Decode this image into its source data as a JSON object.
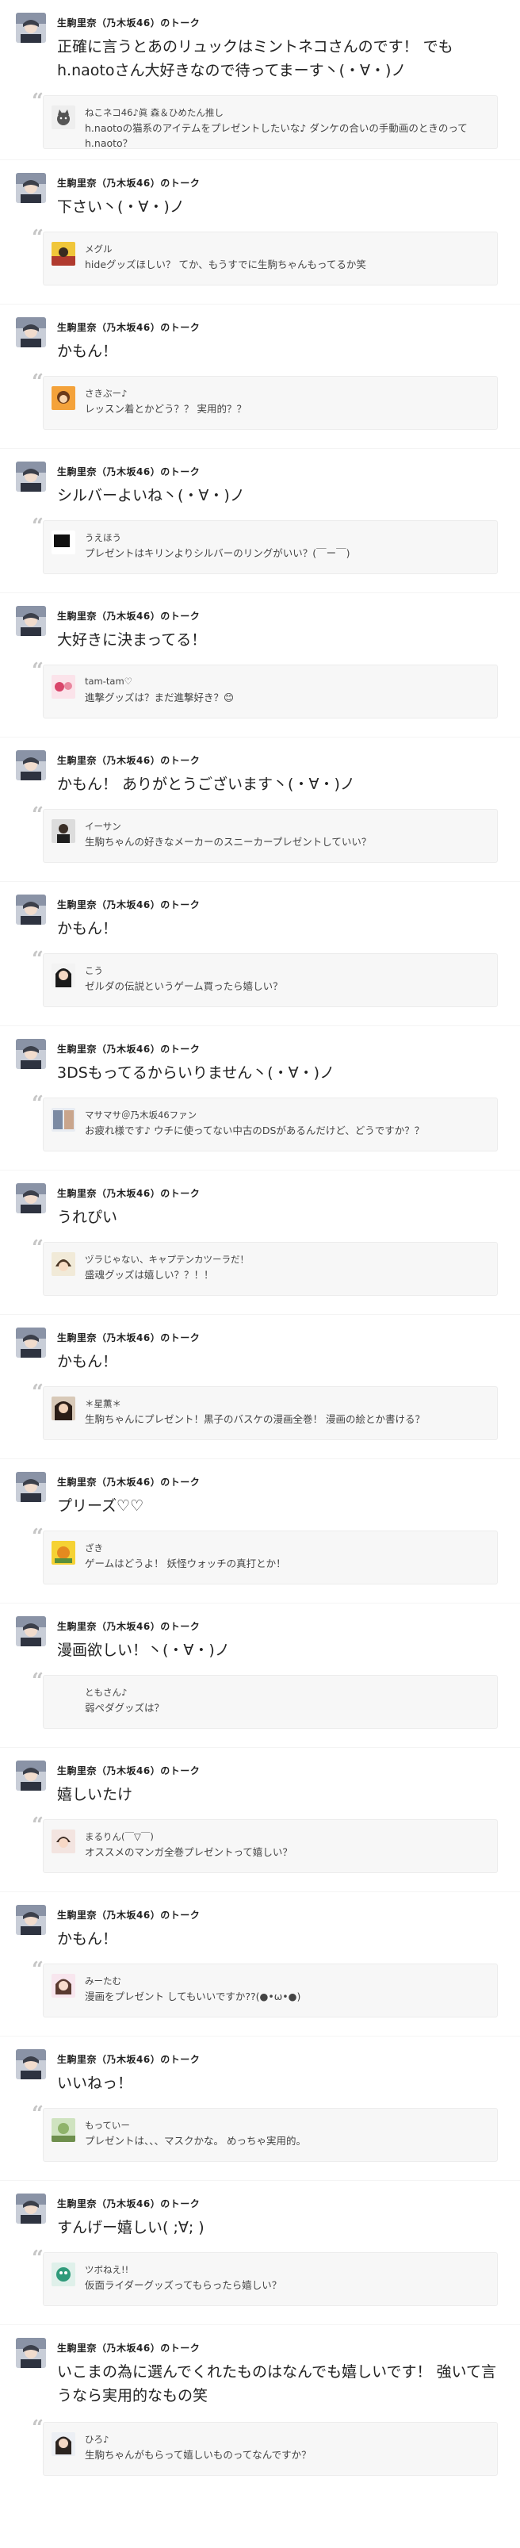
{
  "host_name": "生駒里奈（乃木坂46）のトーク",
  "colors": {
    "host_name_text": "#222222",
    "quote_background": "#f7f7f7",
    "quote_border": "#ececec",
    "quote_mark": "#c6c6c6"
  },
  "items": [
    {
      "reply": "正確に言うとあのリュックはミントネコさんのです！ でもh.naotoさん大好きなので待ってまーす丶(・∀・)ノ",
      "quote_user": "ねこネコ46♪眞 森＆ひめたん推し",
      "quote_text": "h.naotoの猫系のアイテムをプレゼントしたいな♪ ダンケの合いの手動画のときのってh.naoto？",
      "quote_avatar_icon": "cat-avatar-icon"
    },
    {
      "reply": "下さい丶(・∀・)ノ",
      "quote_user": "メグル",
      "quote_text": "hideグッズほしい？ てか、もうすでに生駒ちゃんもってるか笑",
      "quote_avatar_icon": "guitar-avatar-icon"
    },
    {
      "reply": "かもん！",
      "quote_user": "さきぶー♪",
      "quote_text": "レッスン着とかどう？？ 実用的？？",
      "quote_avatar_icon": "character-avatar-icon"
    },
    {
      "reply": "シルバーよいね丶(・∀・)ノ",
      "quote_user": "うえほう",
      "quote_text": "プレゼントはキリンよりシルバーのリングがいい？(￣ー￣)",
      "quote_avatar_icon": "dark-avatar-icon"
    },
    {
      "reply": "大好きに決まってる！",
      "quote_user": "tam-tam♡",
      "quote_text": "進撃グッズは？まだ進撃好き？😊",
      "quote_avatar_icon": "flower-avatar-icon"
    },
    {
      "reply": "かもん！ ありがとうございます丶(・∀・)ノ",
      "quote_user": "イーサン",
      "quote_text": "生駒ちゃんの好きなメーカーのスニーカープレゼントしていい？",
      "quote_avatar_icon": "person-avatar-icon"
    },
    {
      "reply": "かもん！",
      "quote_user": "こう",
      "quote_text": "ゼルダの伝説というゲーム買ったら嬉しい？",
      "quote_avatar_icon": "girl-avatar-icon"
    },
    {
      "reply": "3DSもってるからいりません丶(・∀・)ノ",
      "quote_user": "マサマサ＠乃木坂46ファン",
      "quote_text": "お疲れ様です♪ ウチに使ってない中古のDSがあるんだけど、どうですか？？",
      "quote_avatar_icon": "photo-avatar-icon"
    },
    {
      "reply": "うれぴい",
      "quote_user": "ヅラじゃない、キャプテンカツーラだ！",
      "quote_text": "盛魂グッズは嬉しい？？！！",
      "quote_avatar_icon": "anime-avatar-icon"
    },
    {
      "reply": "かもん！",
      "quote_user": "＊星薫＊",
      "quote_text": "生駒ちゃんにプレゼント！黒子のバスケの漫画全巻！ 漫画の絵とか書ける？",
      "quote_avatar_icon": "portrait-avatar-icon"
    },
    {
      "reply": "プリーズ♡♡",
      "quote_user": "ざき",
      "quote_text": "ゲームはどうよ！ 妖怪ウォッチの真打とか！",
      "quote_avatar_icon": "yellow-avatar-icon"
    },
    {
      "reply": "漫画欲しい！丶(・∀・)ノ",
      "quote_user": "ともさん♪",
      "quote_text": "弱ペダグッズは？",
      "quote_avatar_icon": "blank-avatar-icon"
    },
    {
      "reply": "嬉しいたけ",
      "quote_user": "まるりん(￣▽￣)",
      "quote_text": "オススメのマンガ全巻プレゼントって嬉しい？",
      "quote_avatar_icon": "kid-avatar-icon"
    },
    {
      "reply": "かもん！",
      "quote_user": "みーたむ",
      "quote_text": "漫画をプレゼント してもいいですか??(●•ω•●)",
      "quote_avatar_icon": "pink-avatar-icon"
    },
    {
      "reply": "いいねっ！",
      "quote_user": "もっていー",
      "quote_text": "プレゼントは、、、マスクかな。 めっちゃ実用的。",
      "quote_avatar_icon": "nature-avatar-icon"
    },
    {
      "reply": "すんげー嬉しい( ;∀; )",
      "quote_user": "ツボねえ!!",
      "quote_text": "仮面ライダーグッズってもらったら嬉しい？",
      "quote_avatar_icon": "green-avatar-icon"
    },
    {
      "reply": "いこまの為に選んでくれたものはなんでも嬉しいです！ 強いて言うなら実用的なもの笑",
      "quote_user": "ひろ♪",
      "quote_text": "生駒ちゃんがもらって嬉しいものってなんですか？",
      "quote_avatar_icon": "idol-avatar-icon"
    }
  ]
}
